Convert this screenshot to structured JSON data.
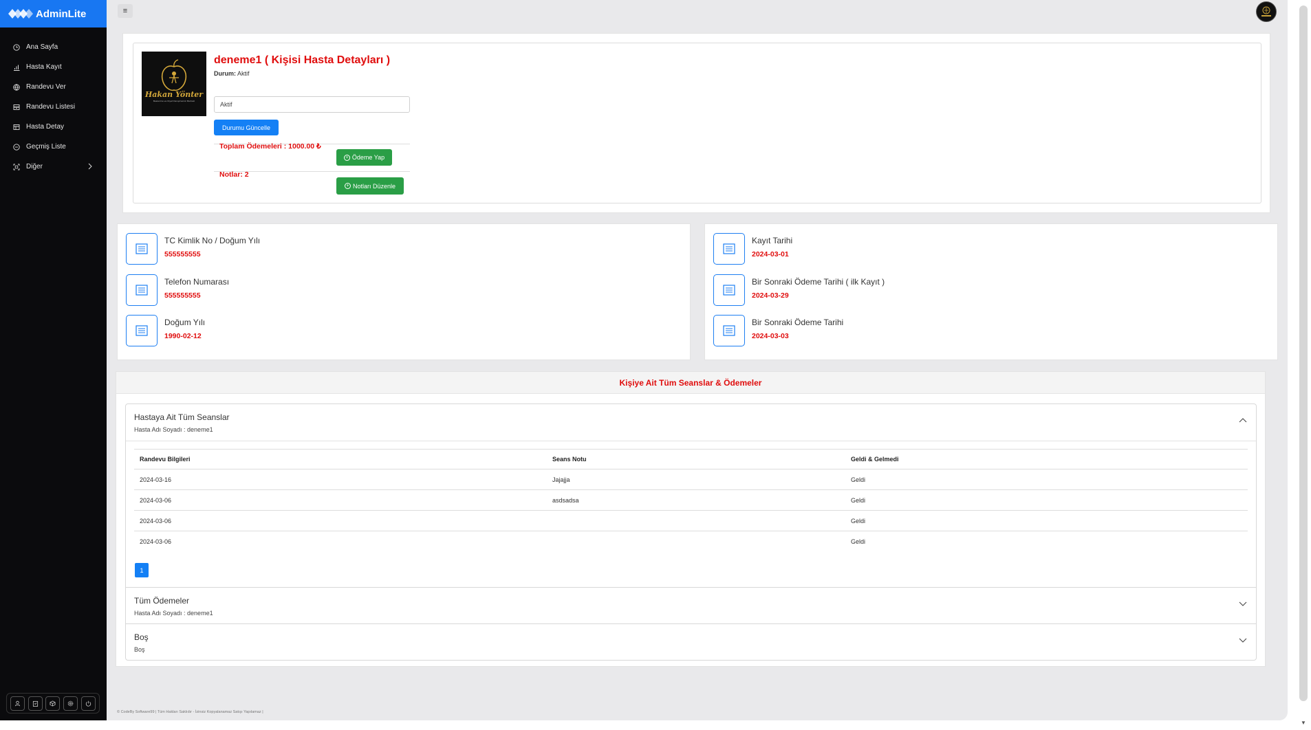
{
  "brand": {
    "name": "AdminLite"
  },
  "sidebar": {
    "items": [
      {
        "label": "Ana Sayfa",
        "icon": "clock-icon"
      },
      {
        "label": "Hasta Kayıt",
        "icon": "bar-chart-icon"
      },
      {
        "label": "Randevu Ver",
        "icon": "globe-icon"
      },
      {
        "label": "Randevu Listesi",
        "icon": "archive-icon"
      },
      {
        "label": "Hasta Detay",
        "icon": "table-icon"
      },
      {
        "label": "Geçmiş Liste",
        "icon": "history-icon"
      },
      {
        "label": "Diğer",
        "icon": "scan-icon"
      }
    ]
  },
  "topbar": {
    "menu_icon": "≡"
  },
  "profile": {
    "name": "deneme1 ( Kişisi Hasta Detayları )",
    "status_label": "Durum:",
    "status_value": "Aktif",
    "status_input": "Aktif",
    "update_button": "Durumu Güncelle",
    "total_payments": "Toplam Ödemeleri : 1000.00 ₺",
    "pay_button": "Ödeme Yap",
    "notes": "Notlar: 2",
    "edit_notes_button": "Notları Düzenle",
    "photo_text_main": "Hakan Yönter",
    "photo_text_sub": "Beslenme ve Diyet Danışmanlık Merkezi"
  },
  "info_left": [
    {
      "title": "TC Kimlik No / Doğum Yılı",
      "value": "555555555"
    },
    {
      "title": "Telefon Numarası",
      "value": "555555555"
    },
    {
      "title": "Doğum Yılı",
      "value": "1990-02-12"
    }
  ],
  "info_right": [
    {
      "title": "Kayıt Tarihi",
      "value": "2024-03-01"
    },
    {
      "title": "Bir Sonraki Ödeme Tarihi ( ilk Kayıt )",
      "value": "2024-03-29"
    },
    {
      "title": "Bir Sonraki Ödeme Tarihi",
      "value": "2024-03-03"
    }
  ],
  "sessions": {
    "header": "Kişiye Ait Tüm Seanslar & Ödemeler",
    "accordion": [
      {
        "title": "Hastaya Ait Tüm Seanslar",
        "subtitle": "Hasta Adı Soyadı : deneme1",
        "expanded": true
      },
      {
        "title": "Tüm Ödemeler",
        "subtitle": "Hasta Adı Soyadı : deneme1",
        "expanded": false
      },
      {
        "title": "Boş",
        "subtitle": "Boş",
        "expanded": false
      }
    ],
    "columns": [
      "Randevu Bilgileri",
      "Seans Notu",
      "Geldi & Gelmedi"
    ],
    "rows": [
      [
        "2024-03-16",
        "Jajajja",
        "Geldi"
      ],
      [
        "2024-03-06",
        "asdsadsa",
        "Geldi"
      ],
      [
        "2024-03-06",
        "",
        "Geldi"
      ],
      [
        "2024-03-06",
        "",
        "Geldi"
      ]
    ],
    "page": "1"
  },
  "footer": {
    "text": "© CodeBy Software99 | Tüm Hakları Saklıdır - İzinsiz Kopyalanamaz Satışı Yapılamaz |"
  },
  "colors": {
    "accent": "#1877f2",
    "danger": "#e00d0d",
    "success": "#2a9e46",
    "sidebar": "#0b0b0d"
  }
}
